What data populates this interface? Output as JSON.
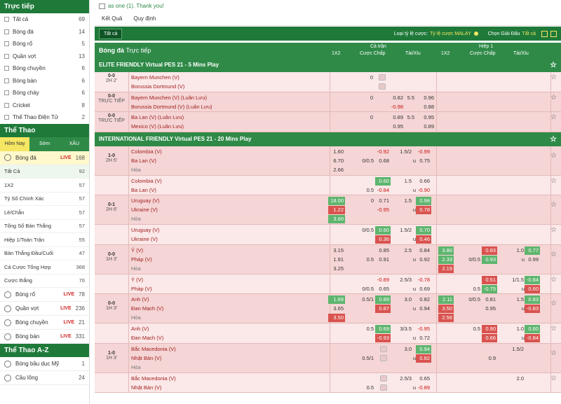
{
  "sidebar": {
    "live_title": "Trực tiếp",
    "live_items": [
      {
        "label": "Tất cả",
        "count": "69"
      },
      {
        "label": "Bóng đá",
        "count": "14"
      },
      {
        "label": "Bóng rổ",
        "count": "5"
      },
      {
        "label": "Quần vợt",
        "count": "13"
      },
      {
        "label": "Bóng chuyền",
        "count": "6"
      },
      {
        "label": "Bóng bàn",
        "count": "6"
      },
      {
        "label": "Bóng chày",
        "count": "6"
      },
      {
        "label": "Cricket",
        "count": "8"
      },
      {
        "label": "Thể Thao Điện Tử",
        "count": "2"
      }
    ],
    "sports_title": "Thể Thao",
    "tabs": [
      "Hôm Nay",
      "Sớm",
      "XÂU"
    ],
    "football": {
      "label": "Bóng đá",
      "live": "LIVE",
      "count": "168"
    },
    "football_sub": [
      {
        "label": "Tất Cả",
        "count": "92"
      },
      {
        "label": "1X2",
        "count": "57"
      },
      {
        "label": "Tỷ Số Chính Xác",
        "count": "57"
      },
      {
        "label": "Lẻ/Chẵn",
        "count": "57"
      },
      {
        "label": "Tổng Số Bàn Thắng",
        "count": "57"
      },
      {
        "label": "Hiệp 1/Toàn Trận",
        "count": "55"
      },
      {
        "label": "Bàn Thắng Đầu/Cuối",
        "count": "47"
      },
      {
        "label": "Cá Cược Tổng Hợp",
        "count": "368"
      },
      {
        "label": "Cược thắng",
        "count": "76"
      }
    ],
    "other_sports": [
      {
        "label": "Bóng rổ",
        "live": "LIVE",
        "count": "78"
      },
      {
        "label": "Quần vợt",
        "live": "LIVE",
        "count": "236"
      },
      {
        "label": "Bóng chuyền",
        "live": "LIVE",
        "count": "21"
      },
      {
        "label": "Bóng bàn",
        "live": "LIVE",
        "count": "331"
      }
    ],
    "az_title": "Thể Thao A-Z",
    "az_items": [
      {
        "label": "Bóng bầu dục Mỹ",
        "count": "1"
      },
      {
        "label": "Cầu lông",
        "count": "24"
      }
    ]
  },
  "marquee": "as one (1). Thank you!",
  "subnav": [
    "Kết Quả",
    "Quy định"
  ],
  "toolbar": {
    "all_tab": "Tất cả",
    "odds_label": "Loại tỷ lệ cược:",
    "odds_value": "Tỷ lệ cược MALAY",
    "league_label": "Chọn Giải Đấu",
    "league_value": "Tất cả"
  },
  "colhead": {
    "sport": "Bóng đá",
    "mode": "Trực tiếp",
    "full": "Cả trận",
    "half": "Hiệp 1",
    "c1x2": "1X2",
    "chap": "Cược Chấp",
    "taixiu": "Tài/Xỉu"
  },
  "leagues": [
    {
      "name": "ELITE FRIENDLY Virtual PES 21 - 5 Mins Play",
      "matches": [
        {
          "score": "0-0",
          "time": "2H 2'",
          "home": "Bayern Munchen (V)",
          "away": "Borussia Dortmund (V)",
          "draw": "",
          "ft_hdp_h": "0",
          "ft_odd_h": "",
          "ft_odd_a": "",
          "ft_ou": "",
          "ft_ou_h": "",
          "ft_ou_a": "",
          "locked": true
        },
        {
          "score": "0-0",
          "time": "TRỰC TIẾP",
          "home": "Bayern Munchen (V) (Luân Lưu)",
          "away": "Borussia Dortmund (V) (Luân Lưu)",
          "draw": "",
          "ft_hdp_h": "0",
          "ft_odd_h": "0.82",
          "ft_odd_a": "-0.98",
          "ft_ou": "5.5",
          "ft_ou_h": "0.96",
          "ft_ou_a": "0.88"
        },
        {
          "score": "0-0",
          "time": "TRỰC TIẾP",
          "home": "Ba Lan (V) (Luân Lưu)",
          "away": "Mexico (V) (Luân Lưu)",
          "draw": "",
          "ft_hdp_h": "0",
          "ft_odd_h": "0.89",
          "ft_odd_a": "0.95",
          "ft_ou": "5.5",
          "ft_ou_h": "0.95",
          "ft_ou_a": "0.89"
        }
      ]
    },
    {
      "name": "INTERNATIONAL FRIENDLY Virtual PES 21 - 20 Mins Play",
      "rows": [
        {
          "score": "1-0",
          "time": "2H 5'",
          "home": "Colombia (V)",
          "away": "Ba Lan (V)",
          "draw": "Hòa",
          "x1": "1.60",
          "x2": "6.70",
          "xd": "2.66",
          "hdp_h": "",
          "hdp_a": "0/0.5",
          "odd_h": "-0.92",
          "odd_a": "0.68",
          "ou": "1.5/2",
          "ou_h": "-0.99",
          "ou_a": "0.75",
          "ou_u": "u"
        },
        {
          "score": "",
          "time": "",
          "home": "Colombia (V)",
          "away": "Ba Lan (V)",
          "draw": "",
          "x1": "",
          "x2": "",
          "xd": "",
          "hdp_h": "",
          "hdp_a": "0.5",
          "odd_h": "0.60",
          "odd_a": "-0.84",
          "ou": "1.5",
          "ou_h": "0.66",
          "ou_a": "-0.90",
          "ou_u": "u"
        },
        {
          "score": "0-1",
          "time": "2H 6'",
          "home": "Uruguay (V)",
          "away": "Ukraine (V)",
          "draw": "Hòa",
          "x1": "18.00",
          "x2": "1.22",
          "xd": "3.60",
          "hdp_h": "0",
          "hdp_a": "",
          "odd_h": "0.71",
          "odd_a": "-0.95",
          "ou": "1.5",
          "ou_h": "0.98",
          "ou_a": "0.78",
          "ou_u": "u"
        },
        {
          "score": "",
          "time": "",
          "home": "Uruguay (V)",
          "away": "Ukraine (V)",
          "draw": "",
          "x1": "",
          "x2": "",
          "xd": "",
          "hdp_h": "0/0.5",
          "hdp_a": "",
          "odd_h": "0.60",
          "odd_a": "0.36",
          "ou": "1.5/2",
          "ou_h": "0.70",
          "ou_a": "0.46",
          "ou_u": "u"
        },
        {
          "score": "0-0",
          "time": "1H 3'",
          "home": "Ý (V)",
          "away": "Pháp (V)",
          "draw": "Hòa",
          "x1": "3.15",
          "x2": "1.91",
          "xd": "3.25",
          "hdp_h": "",
          "hdp_a": "0.5",
          "odd_h": "0.85",
          "odd_a": "0.91",
          "ou": "2.5",
          "ou_h": "0.84",
          "ou_a": "0.92",
          "ou_u": "u",
          "h1_1": "3.80",
          "h1_2": "2.33",
          "h1_d": "2.19",
          "h1_hdp_a": "0/0.5",
          "h1_odd_h": "0.83",
          "h1_odd_a": "0.93",
          "h1_ou": "1.0",
          "h1_ou_h": "0.77",
          "h1_ou_a": "0.99"
        },
        {
          "score": "",
          "time": "",
          "home": "Ý (V)",
          "away": "Pháp (V)",
          "draw": "",
          "x1": "",
          "x2": "",
          "xd": "",
          "hdp_h": "",
          "hdp_a": "0/0.5",
          "odd_h": "-0.89",
          "odd_a": "0.65",
          "ou": "2.5/3",
          "ou_h": "-0.78",
          "ou_a": "0.69",
          "ou_u": "u",
          "h1_1": "",
          "h1_2": "",
          "h1_d": "",
          "h1_hdp_a": "0.5",
          "h1_odd_h": "0.51",
          "h1_odd_a": "-0.75",
          "h1_ou": "1/1.5",
          "h1_ou_h": "-0.84",
          "h1_ou_a": "0.60"
        },
        {
          "score": "0-0",
          "time": "1H 3'",
          "home": "Anh (V)",
          "away": "Đan Mạch (V)",
          "draw": "Hòa",
          "x1": "1.69",
          "x2": "3.65",
          "xd": "3.50",
          "hdp_h": "0.5/1",
          "hdp_a": "",
          "odd_h": "0.89",
          "odd_a": "0.87",
          "ou": "3.0",
          "ou_h": "0.82",
          "ou_a": "0.94",
          "ou_u": "u",
          "h1_1": "2.11",
          "h1_2": "3.50",
          "h1_d": "2.56",
          "h1_hdp_h": "0/0.5",
          "h1_odd_h": "0.81",
          "h1_odd_a": "0.95",
          "h1_ou": "1.5",
          "h1_ou_h": "0.83",
          "h1_ou_a": "-0.83"
        },
        {
          "score": "",
          "time": "",
          "home": "Anh (V)",
          "away": "Đan Mạch (V)",
          "draw": "",
          "x1": "",
          "x2": "",
          "xd": "",
          "hdp_h": "0.5",
          "hdp_a": "",
          "odd_h": "0.69",
          "odd_a": "-0.93",
          "ou": "3/3.5",
          "ou_h": "-0.95",
          "ou_a": "0.72",
          "ou_u": "u",
          "h1_1": "",
          "h1_2": "",
          "h1_d": "",
          "h1_hdp_h": "0.5",
          "h1_odd_h": "0.90",
          "h1_odd_a": "0.66",
          "h1_ou": "1.0",
          "h1_ou_h": "0.60",
          "h1_ou_a": "-0.84"
        },
        {
          "score": "1-0",
          "time": "1H 3'",
          "home": "Bắc Macedonia (V)",
          "away": "Nhật Bản (V)",
          "draw": "Hòa",
          "x1": "",
          "x2": "",
          "xd": "",
          "hdp_h": "",
          "hdp_a": "0.5/1",
          "odd_h": "",
          "odd_a": "",
          "ou": "3.0",
          "ou_h": "0.94",
          "ou_a": "0.82",
          "ou_u": "u",
          "h1_1": "",
          "h1_2": "",
          "h1_d": "",
          "h1_hdp_h": "",
          "h1_odd_h": "",
          "h1_odd_a": "0.9",
          "h1_ou": "1.5/2",
          "h1_ou_h": "",
          "h1_ou_a": ""
        },
        {
          "score": "",
          "time": "",
          "home": "Bắc Macedonia (V)",
          "away": "Nhật Bản (V)",
          "draw": "",
          "x1": "",
          "x2": "",
          "xd": "",
          "hdp_h": "",
          "hdp_a": "0.5",
          "odd_h": "",
          "odd_a": "",
          "ou": "2.5/3",
          "ou_h": "0.65",
          "ou_a": "-0.89",
          "ou_u": "u",
          "h1_1": "",
          "h1_2": "",
          "h1_d": "",
          "h1_hdp_h": "",
          "h1_odd_h": "",
          "h1_odd_a": "",
          "h1_ou": "2.0",
          "h1_ou_h": "",
          "h1_ou_a": ""
        }
      ]
    }
  ]
}
